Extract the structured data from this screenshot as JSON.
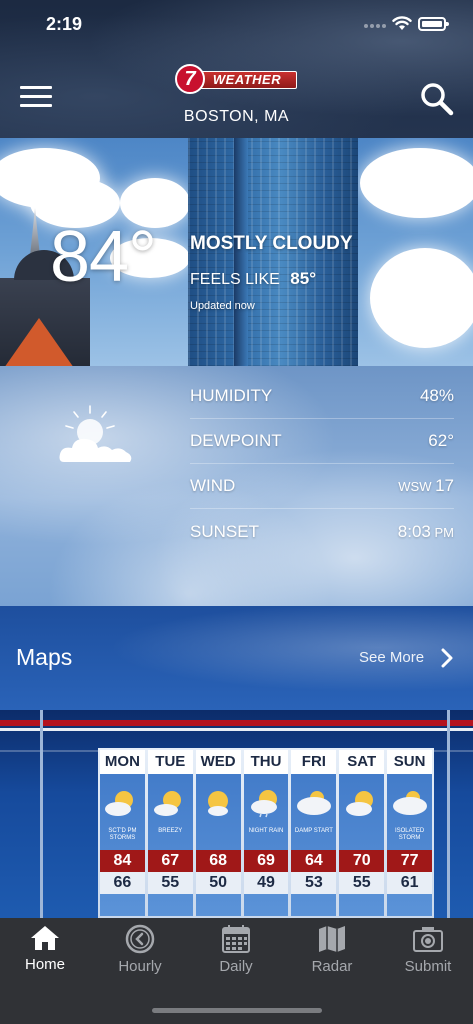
{
  "status_bar": {
    "time": "2:19"
  },
  "header": {
    "logo_number": "7",
    "logo_word": "WEATHER",
    "location": "BOSTON, MA"
  },
  "current": {
    "temperature": "84°",
    "condition": "MOSTLY CLOUDY",
    "feels_like_label": "FEELS LIKE",
    "feels_like_value": "85°",
    "updated": "Updated now"
  },
  "details": [
    {
      "label": "HUMIDITY",
      "value": "48%",
      "unit": ""
    },
    {
      "label": "DEWPOINT",
      "value": "62°",
      "unit": ""
    },
    {
      "label": "WIND",
      "value": "17",
      "unit": "WSW "
    },
    {
      "label": "SUNSET",
      "value": "8:03",
      "unit": " PM"
    }
  ],
  "maps": {
    "title": "Maps",
    "see_more": "See More"
  },
  "forecast": [
    {
      "day": "MON",
      "note": "SCT'D PM STORMS",
      "hi": "84",
      "lo": "66",
      "icon": "partly-cloudy-icon"
    },
    {
      "day": "TUE",
      "note": "BREEZY",
      "hi": "67",
      "lo": "55",
      "icon": "partly-cloudy-icon"
    },
    {
      "day": "WED",
      "note": "",
      "hi": "68",
      "lo": "50",
      "icon": "mostly-sunny-icon"
    },
    {
      "day": "THU",
      "note": "NIGHT RAIN",
      "hi": "69",
      "lo": "49",
      "icon": "partly-cloudy-rain-icon"
    },
    {
      "day": "FRI",
      "note": "DAMP START",
      "hi": "64",
      "lo": "53",
      "icon": "cloudy-icon"
    },
    {
      "day": "SAT",
      "note": "",
      "hi": "70",
      "lo": "55",
      "icon": "partly-cloudy-icon"
    },
    {
      "day": "SUN",
      "note": "ISOLATED STORM",
      "hi": "77",
      "lo": "61",
      "icon": "cloudy-icon"
    }
  ],
  "tabs": [
    {
      "label": "Home",
      "icon": "home-icon",
      "active": true
    },
    {
      "label": "Hourly",
      "icon": "clock-icon",
      "active": false
    },
    {
      "label": "Daily",
      "icon": "calendar-icon",
      "active": false
    },
    {
      "label": "Radar",
      "icon": "map-icon",
      "active": false
    },
    {
      "label": "Submit",
      "icon": "camera-icon",
      "active": false
    }
  ],
  "colors": {
    "brand_red": "#c8102e",
    "header_bg": "#1c2a42",
    "tab_bar_bg": "#303236",
    "forecast_high_bg": "#a01818"
  }
}
